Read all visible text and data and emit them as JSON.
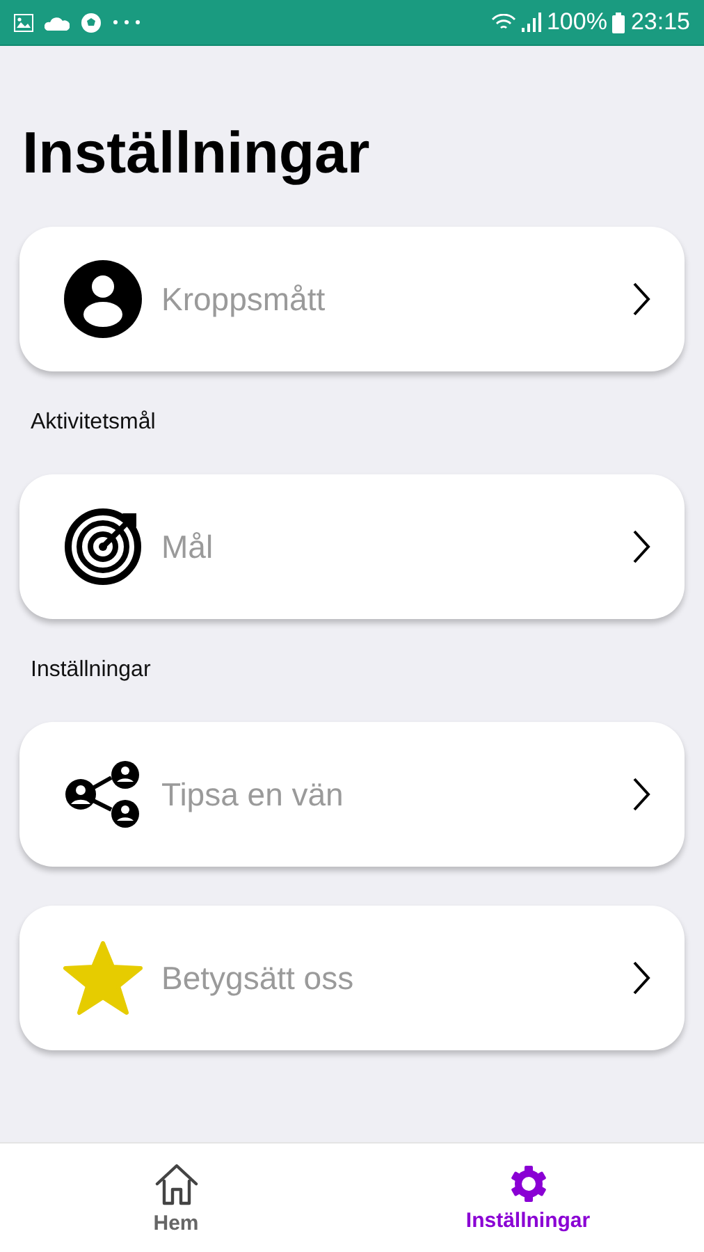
{
  "status_bar": {
    "battery": "100%",
    "time": "23:15"
  },
  "title": "Inställningar",
  "sections": [
    {
      "items": [
        {
          "label": "Kroppsmått"
        }
      ]
    },
    {
      "heading": "Aktivitetsmål",
      "items": [
        {
          "label": "Mål"
        }
      ]
    },
    {
      "heading": "Inställningar",
      "items": [
        {
          "label": "Tipsa en vän"
        },
        {
          "label": "Betygsätt oss"
        }
      ]
    }
  ],
  "bottom_nav": [
    {
      "label": "Hem",
      "selected": false
    },
    {
      "label": "Inställningar",
      "selected": true
    }
  ]
}
